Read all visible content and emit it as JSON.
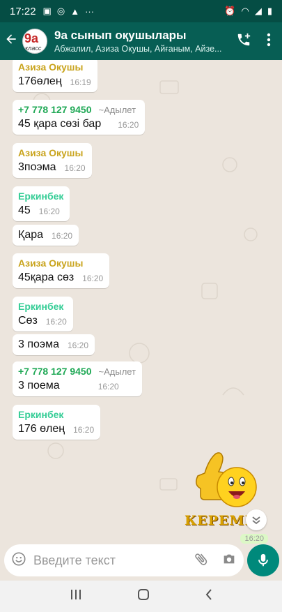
{
  "status_bar": {
    "time": "17:22"
  },
  "header": {
    "avatar_main": "9а",
    "avatar_sub": "класс",
    "title": "9а сынып оқушылары",
    "subtitle": "Абжалил, Азиза Окушы, Айғаным, Айзе..."
  },
  "messages": [
    {
      "sender": "Азиза Окушы",
      "alias": "",
      "text": "176өлең",
      "time": "16:19"
    },
    {
      "sender": "+7 778 127 9450",
      "alias": "~Адылет",
      "text": "45 қара сөзі бар",
      "time": "16:20"
    },
    {
      "sender": "Азиза Окушы",
      "alias": "",
      "text": "3поэма",
      "time": "16:20"
    },
    {
      "sender": "Еркинбек",
      "alias": "",
      "text": "45",
      "time": "16:20"
    },
    {
      "sender": "",
      "alias": "",
      "text": "Қара",
      "time": "16:20"
    },
    {
      "sender": "Азиза Окушы",
      "alias": "",
      "text": "45қара сөз",
      "time": "16:20"
    },
    {
      "sender": "Еркинбек",
      "alias": "",
      "text": "Сөз",
      "time": "16:20"
    },
    {
      "sender": "",
      "alias": "",
      "text": "3 поэма",
      "time": "16:20"
    },
    {
      "sender": "+7 778 127 9450",
      "alias": "~Адылет",
      "text": "3 поема",
      "time": "16:20"
    },
    {
      "sender": "Еркинбек",
      "alias": "",
      "text": "176 өлең",
      "time": "16:20"
    }
  ],
  "sticker": {
    "text": "КЕРЕМЕТ",
    "time": "16:20"
  },
  "input": {
    "placeholder": "Введите текст"
  },
  "colors": {
    "header": "#075e54",
    "accent": "#00897b",
    "chat_bg": "#ece5dd"
  },
  "icons": [
    "back-arrow-icon",
    "add-call-icon",
    "more-vert-icon",
    "emoji-icon",
    "attach-icon",
    "camera-icon",
    "mic-icon",
    "chevron-down-icon"
  ]
}
